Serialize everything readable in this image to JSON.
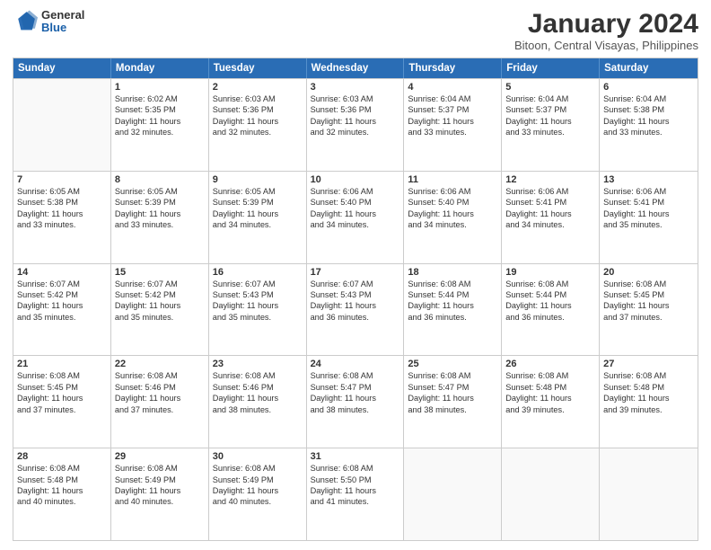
{
  "logo": {
    "general": "General",
    "blue": "Blue"
  },
  "title": "January 2024",
  "subtitle": "Bitoon, Central Visayas, Philippines",
  "days": [
    "Sunday",
    "Monday",
    "Tuesday",
    "Wednesday",
    "Thursday",
    "Friday",
    "Saturday"
  ],
  "weeks": [
    [
      {
        "day": "",
        "sunrise": "",
        "sunset": "",
        "daylight": "",
        "daylight2": ""
      },
      {
        "day": "1",
        "sunrise": "Sunrise: 6:02 AM",
        "sunset": "Sunset: 5:35 PM",
        "daylight": "Daylight: 11 hours",
        "daylight2": "and 32 minutes."
      },
      {
        "day": "2",
        "sunrise": "Sunrise: 6:03 AM",
        "sunset": "Sunset: 5:36 PM",
        "daylight": "Daylight: 11 hours",
        "daylight2": "and 32 minutes."
      },
      {
        "day": "3",
        "sunrise": "Sunrise: 6:03 AM",
        "sunset": "Sunset: 5:36 PM",
        "daylight": "Daylight: 11 hours",
        "daylight2": "and 32 minutes."
      },
      {
        "day": "4",
        "sunrise": "Sunrise: 6:04 AM",
        "sunset": "Sunset: 5:37 PM",
        "daylight": "Daylight: 11 hours",
        "daylight2": "and 33 minutes."
      },
      {
        "day": "5",
        "sunrise": "Sunrise: 6:04 AM",
        "sunset": "Sunset: 5:37 PM",
        "daylight": "Daylight: 11 hours",
        "daylight2": "and 33 minutes."
      },
      {
        "day": "6",
        "sunrise": "Sunrise: 6:04 AM",
        "sunset": "Sunset: 5:38 PM",
        "daylight": "Daylight: 11 hours",
        "daylight2": "and 33 minutes."
      }
    ],
    [
      {
        "day": "7",
        "sunrise": "Sunrise: 6:05 AM",
        "sunset": "Sunset: 5:38 PM",
        "daylight": "Daylight: 11 hours",
        "daylight2": "and 33 minutes."
      },
      {
        "day": "8",
        "sunrise": "Sunrise: 6:05 AM",
        "sunset": "Sunset: 5:39 PM",
        "daylight": "Daylight: 11 hours",
        "daylight2": "and 33 minutes."
      },
      {
        "day": "9",
        "sunrise": "Sunrise: 6:05 AM",
        "sunset": "Sunset: 5:39 PM",
        "daylight": "Daylight: 11 hours",
        "daylight2": "and 34 minutes."
      },
      {
        "day": "10",
        "sunrise": "Sunrise: 6:06 AM",
        "sunset": "Sunset: 5:40 PM",
        "daylight": "Daylight: 11 hours",
        "daylight2": "and 34 minutes."
      },
      {
        "day": "11",
        "sunrise": "Sunrise: 6:06 AM",
        "sunset": "Sunset: 5:40 PM",
        "daylight": "Daylight: 11 hours",
        "daylight2": "and 34 minutes."
      },
      {
        "day": "12",
        "sunrise": "Sunrise: 6:06 AM",
        "sunset": "Sunset: 5:41 PM",
        "daylight": "Daylight: 11 hours",
        "daylight2": "and 34 minutes."
      },
      {
        "day": "13",
        "sunrise": "Sunrise: 6:06 AM",
        "sunset": "Sunset: 5:41 PM",
        "daylight": "Daylight: 11 hours",
        "daylight2": "and 35 minutes."
      }
    ],
    [
      {
        "day": "14",
        "sunrise": "Sunrise: 6:07 AM",
        "sunset": "Sunset: 5:42 PM",
        "daylight": "Daylight: 11 hours",
        "daylight2": "and 35 minutes."
      },
      {
        "day": "15",
        "sunrise": "Sunrise: 6:07 AM",
        "sunset": "Sunset: 5:42 PM",
        "daylight": "Daylight: 11 hours",
        "daylight2": "and 35 minutes."
      },
      {
        "day": "16",
        "sunrise": "Sunrise: 6:07 AM",
        "sunset": "Sunset: 5:43 PM",
        "daylight": "Daylight: 11 hours",
        "daylight2": "and 35 minutes."
      },
      {
        "day": "17",
        "sunrise": "Sunrise: 6:07 AM",
        "sunset": "Sunset: 5:43 PM",
        "daylight": "Daylight: 11 hours",
        "daylight2": "and 36 minutes."
      },
      {
        "day": "18",
        "sunrise": "Sunrise: 6:08 AM",
        "sunset": "Sunset: 5:44 PM",
        "daylight": "Daylight: 11 hours",
        "daylight2": "and 36 minutes."
      },
      {
        "day": "19",
        "sunrise": "Sunrise: 6:08 AM",
        "sunset": "Sunset: 5:44 PM",
        "daylight": "Daylight: 11 hours",
        "daylight2": "and 36 minutes."
      },
      {
        "day": "20",
        "sunrise": "Sunrise: 6:08 AM",
        "sunset": "Sunset: 5:45 PM",
        "daylight": "Daylight: 11 hours",
        "daylight2": "and 37 minutes."
      }
    ],
    [
      {
        "day": "21",
        "sunrise": "Sunrise: 6:08 AM",
        "sunset": "Sunset: 5:45 PM",
        "daylight": "Daylight: 11 hours",
        "daylight2": "and 37 minutes."
      },
      {
        "day": "22",
        "sunrise": "Sunrise: 6:08 AM",
        "sunset": "Sunset: 5:46 PM",
        "daylight": "Daylight: 11 hours",
        "daylight2": "and 37 minutes."
      },
      {
        "day": "23",
        "sunrise": "Sunrise: 6:08 AM",
        "sunset": "Sunset: 5:46 PM",
        "daylight": "Daylight: 11 hours",
        "daylight2": "and 38 minutes."
      },
      {
        "day": "24",
        "sunrise": "Sunrise: 6:08 AM",
        "sunset": "Sunset: 5:47 PM",
        "daylight": "Daylight: 11 hours",
        "daylight2": "and 38 minutes."
      },
      {
        "day": "25",
        "sunrise": "Sunrise: 6:08 AM",
        "sunset": "Sunset: 5:47 PM",
        "daylight": "Daylight: 11 hours",
        "daylight2": "and 38 minutes."
      },
      {
        "day": "26",
        "sunrise": "Sunrise: 6:08 AM",
        "sunset": "Sunset: 5:48 PM",
        "daylight": "Daylight: 11 hours",
        "daylight2": "and 39 minutes."
      },
      {
        "day": "27",
        "sunrise": "Sunrise: 6:08 AM",
        "sunset": "Sunset: 5:48 PM",
        "daylight": "Daylight: 11 hours",
        "daylight2": "and 39 minutes."
      }
    ],
    [
      {
        "day": "28",
        "sunrise": "Sunrise: 6:08 AM",
        "sunset": "Sunset: 5:48 PM",
        "daylight": "Daylight: 11 hours",
        "daylight2": "and 40 minutes."
      },
      {
        "day": "29",
        "sunrise": "Sunrise: 6:08 AM",
        "sunset": "Sunset: 5:49 PM",
        "daylight": "Daylight: 11 hours",
        "daylight2": "and 40 minutes."
      },
      {
        "day": "30",
        "sunrise": "Sunrise: 6:08 AM",
        "sunset": "Sunset: 5:49 PM",
        "daylight": "Daylight: 11 hours",
        "daylight2": "and 40 minutes."
      },
      {
        "day": "31",
        "sunrise": "Sunrise: 6:08 AM",
        "sunset": "Sunset: 5:50 PM",
        "daylight": "Daylight: 11 hours",
        "daylight2": "and 41 minutes."
      },
      {
        "day": "",
        "sunrise": "",
        "sunset": "",
        "daylight": "",
        "daylight2": ""
      },
      {
        "day": "",
        "sunrise": "",
        "sunset": "",
        "daylight": "",
        "daylight2": ""
      },
      {
        "day": "",
        "sunrise": "",
        "sunset": "",
        "daylight": "",
        "daylight2": ""
      }
    ]
  ]
}
